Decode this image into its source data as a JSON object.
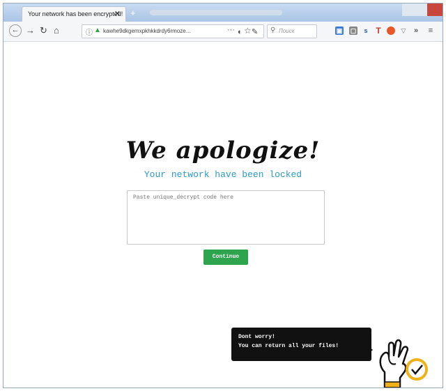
{
  "browser": {
    "tab_title": "Your network has been encrypted!",
    "tab_close": "✕",
    "new_tab": "+",
    "url": "kawhe9dkgemxpkhkkdrdy6rmoze...",
    "url_more": "···",
    "search_placeholder": "Поиск"
  },
  "page": {
    "heading": "We apologize!",
    "subheading": "Your network have been locked",
    "code_placeholder": "Paste unique_decrypt code here",
    "continue_label": "Continue",
    "tooltip_line1": "Dont worry!",
    "tooltip_line2": "You can return all your files!"
  },
  "colors": {
    "accent": "#2ea44f",
    "subheading": "#2b9ac6",
    "tooltip_bg": "#111111",
    "badge": "#f0b21a"
  },
  "icons": [
    "back-icon",
    "forward-icon",
    "reload-icon",
    "home-icon",
    "info-icon",
    "lock-icon",
    "star-icon",
    "shield-icon",
    "tracking-icon",
    "search-icon",
    "extension-icons",
    "overflow-icon",
    "menu-icon",
    "ok-hand-icon",
    "check-badge-icon"
  ]
}
